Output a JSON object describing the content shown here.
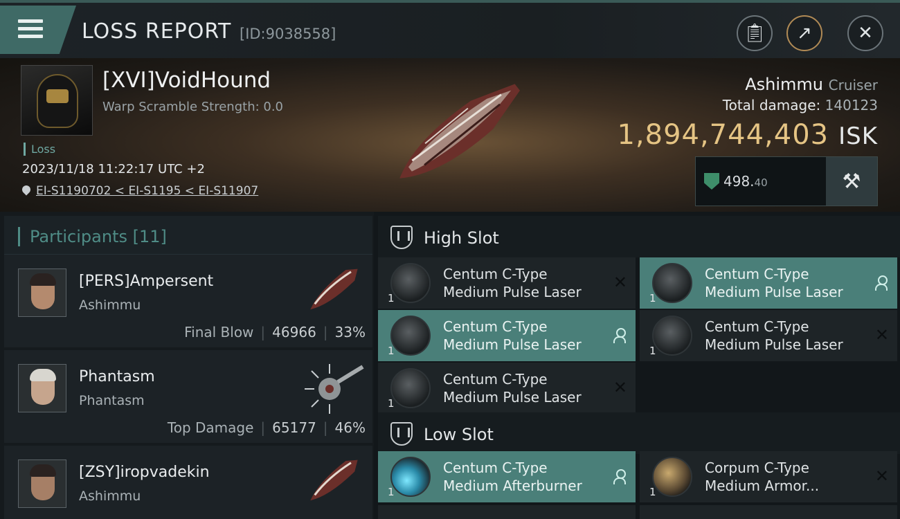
{
  "header": {
    "title": "LOSS REPORT",
    "report_id": "[ID:9038558]",
    "buttons": [
      "clipboard-icon",
      "share-icon",
      "close-icon"
    ]
  },
  "victim": {
    "name": "[XVI]VoidHound",
    "warp_scramble": "Warp Scramble Strength: 0.0",
    "status": "Loss",
    "datetime": "2023/11/18 11:22:17 UTC +2",
    "location": "EI-S1190702 < EI-S1195 < EI-S11907"
  },
  "ship": {
    "name": "Ashimmu",
    "class": "Cruiser",
    "total_damage_label": "Total damage:",
    "total_damage": "140123",
    "value": "1,894,744,403",
    "unit": "ISK",
    "rating_int": "498.",
    "rating_dec": "40"
  },
  "participants": {
    "label": "Participants",
    "count": "[11]",
    "rows": [
      {
        "name": "[PERS]Ampersent",
        "ship": "Ashimmu",
        "tag": "Final Blow",
        "damage": "46966",
        "pct": "33%"
      },
      {
        "name": "Phantasm",
        "ship": "Phantasm",
        "tag": "Top Damage",
        "damage": "65177",
        "pct": "46%"
      },
      {
        "name": "[ZSY]iropvadekin",
        "ship": "Ashimmu",
        "tag": "",
        "damage": "",
        "pct": ""
      }
    ]
  },
  "slots": {
    "high_label": "High Slot",
    "low_label": "Low Slot",
    "high": [
      {
        "line1": "Centum C-Type",
        "line2": "Medium Pulse Laser",
        "qty": "1",
        "state": "destroyed"
      },
      {
        "line1": "Centum C-Type",
        "line2": "Medium Pulse Laser",
        "qty": "1",
        "state": "dropped"
      },
      {
        "line1": "Centum C-Type",
        "line2": "Medium Pulse Laser",
        "qty": "1",
        "state": "dropped"
      },
      {
        "line1": "Centum C-Type",
        "line2": "Medium Pulse Laser",
        "qty": "1",
        "state": "destroyed"
      },
      {
        "line1": "Centum C-Type",
        "line2": "Medium Pulse Laser",
        "qty": "1",
        "state": "destroyed"
      }
    ],
    "low": [
      {
        "line1": "Centum C-Type",
        "line2": "Medium Afterburner",
        "qty": "1",
        "state": "dropped"
      },
      {
        "line1": "Corpum C-Type",
        "line2": "Medium Armor...",
        "qty": "1",
        "state": "destroyed"
      }
    ]
  },
  "colors": {
    "accent": "#4a7f79",
    "isk": "#e5c484",
    "teal_text": "#4f8c86"
  }
}
